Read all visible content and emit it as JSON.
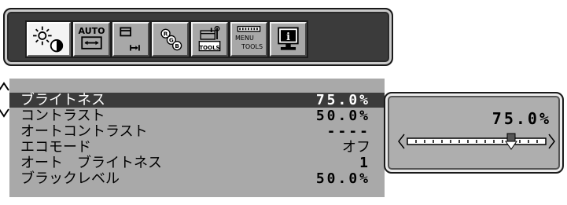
{
  "menu": {
    "tabs": [
      {
        "icon": "brightness-contrast-icon"
      },
      {
        "label": "AUTO",
        "icon": "auto-adjust-icon"
      },
      {
        "icon": "position-size-icon"
      },
      {
        "icon": "rgb-color-icon"
      },
      {
        "label": "TOOLS",
        "icon": "tools-icon"
      },
      {
        "label": "MENU TOOLS",
        "label_line1": "MENU",
        "label_line2": "TOOLS",
        "icon": "menu-tools-icon"
      },
      {
        "icon": "information-icon"
      }
    ],
    "selected_index": 0
  },
  "settings": [
    {
      "label": "ブライトネス",
      "value": "75.0%"
    },
    {
      "label": "コントラスト",
      "value": "50.0%"
    },
    {
      "label": "オートコントラスト",
      "value": "----"
    },
    {
      "label": "エコモード",
      "value": "オフ"
    },
    {
      "label": "オート　ブライトネス",
      "value": "1"
    },
    {
      "label": "ブラックレベル",
      "value": "50.0%"
    }
  ],
  "selected_setting": 0,
  "popup": {
    "value": "75.0%",
    "slider_level": 0.75
  },
  "colors": {
    "panel": "#a9a9a9",
    "highlight": "#3b3b3b",
    "bar": "#3b3b3b"
  }
}
